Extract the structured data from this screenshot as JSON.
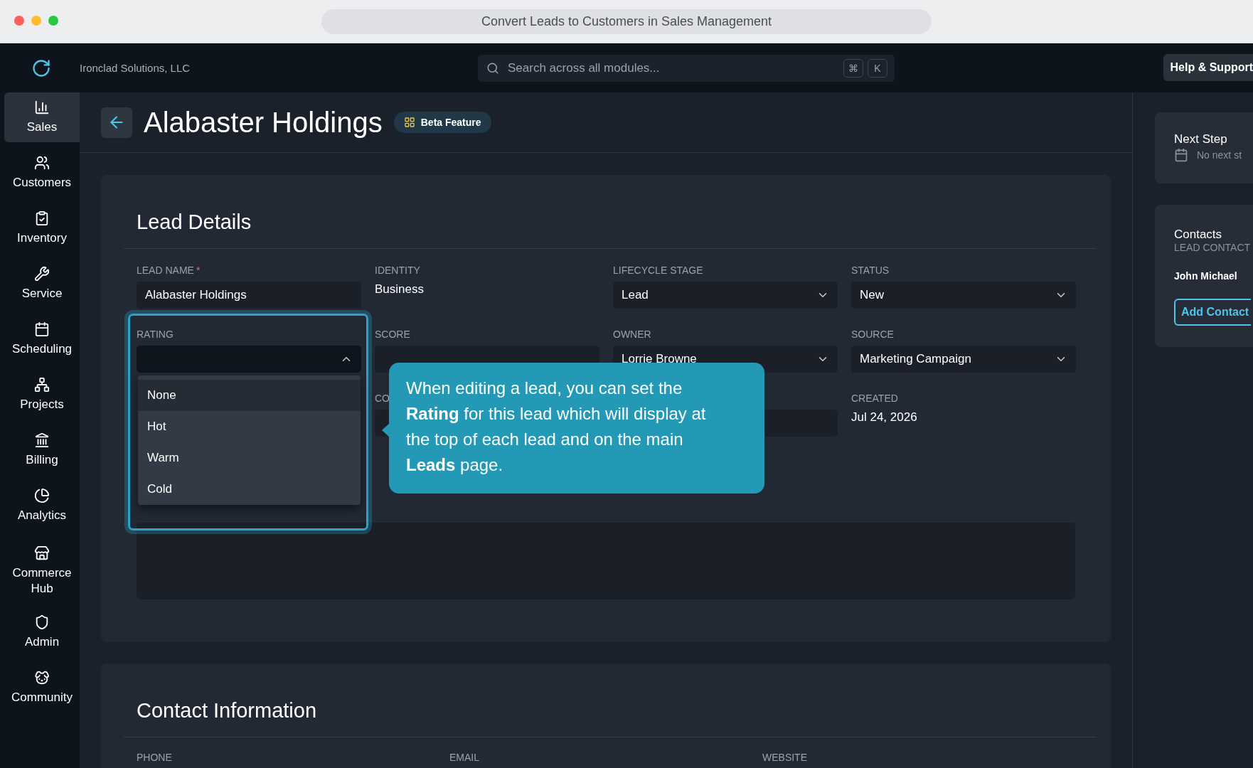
{
  "window": {
    "title": "Convert Leads to Customers in Sales Management"
  },
  "topbar": {
    "company": "Ironclad Solutions, LLC",
    "search": {
      "placeholder": "Search across all modules...",
      "keys": [
        "⌘",
        "K"
      ]
    },
    "help_button": "Help & Support"
  },
  "sidebar": {
    "items": [
      {
        "label": "Sales",
        "selected": true
      },
      {
        "label": "Customers",
        "selected": false
      },
      {
        "label": "Inventory",
        "selected": false
      },
      {
        "label": "Service",
        "selected": false
      },
      {
        "label": "Scheduling",
        "selected": false
      },
      {
        "label": "Projects",
        "selected": false
      },
      {
        "label": "Billing",
        "selected": false
      },
      {
        "label": "Analytics",
        "selected": false
      },
      {
        "label": "Commerce Hub",
        "selected": false
      },
      {
        "label": "Admin",
        "selected": false
      },
      {
        "label": "Community",
        "selected": false
      }
    ]
  },
  "header": {
    "title": "Alabaster Holdings",
    "badge": "Beta Feature"
  },
  "lead_details": {
    "title": "Lead Details",
    "rows": [
      [
        {
          "kind": "input",
          "label": "LEAD NAME",
          "required_mark": "*",
          "value": "Alabaster Holdings"
        },
        {
          "kind": "text",
          "label": "IDENTITY",
          "value": "Business"
        },
        {
          "kind": "select",
          "label": "LIFECYCLE STAGE",
          "value": "Lead"
        },
        {
          "kind": "select",
          "label": "STATUS",
          "value": "New"
        }
      ],
      [
        {
          "kind": "dropdown",
          "label": "RATING",
          "open": true,
          "options": [
            {
              "label": "None",
              "selected": true
            },
            {
              "label": "Hot",
              "selected": false
            },
            {
              "label": "Warm",
              "selected": false
            },
            {
              "label": "Cold",
              "selected": false
            }
          ]
        },
        {
          "kind": "input",
          "label": "SCORE"
        },
        {
          "kind": "select",
          "label": "OWNER",
          "value": "Lorrie Browne"
        },
        {
          "kind": "select",
          "label": "SOURCE",
          "value": "Marketing Campaign"
        }
      ],
      [
        {
          "kind": "covered"
        },
        {
          "kind": "input",
          "label": "CO"
        },
        {
          "kind": "input"
        },
        {
          "kind": "text",
          "label": "CREATED",
          "value": "Jul 24, 2026"
        }
      ]
    ]
  },
  "tooltip": {
    "text": "When editing a lead, you can set the **Rating** for this lead which will display at the top of each lead and on the main **Leads** page."
  },
  "contact_information": {
    "title": "Contact Information",
    "columns": [
      "PHONE",
      "EMAIL",
      "WEBSITE"
    ]
  },
  "right_panel": {
    "next_step": {
      "title": "Next Step",
      "text": "No next st"
    },
    "contacts": {
      "title": "Contacts",
      "subtitle": "LEAD CONTACT",
      "names": [
        "John Michael"
      ],
      "button": "Add Contact"
    }
  }
}
